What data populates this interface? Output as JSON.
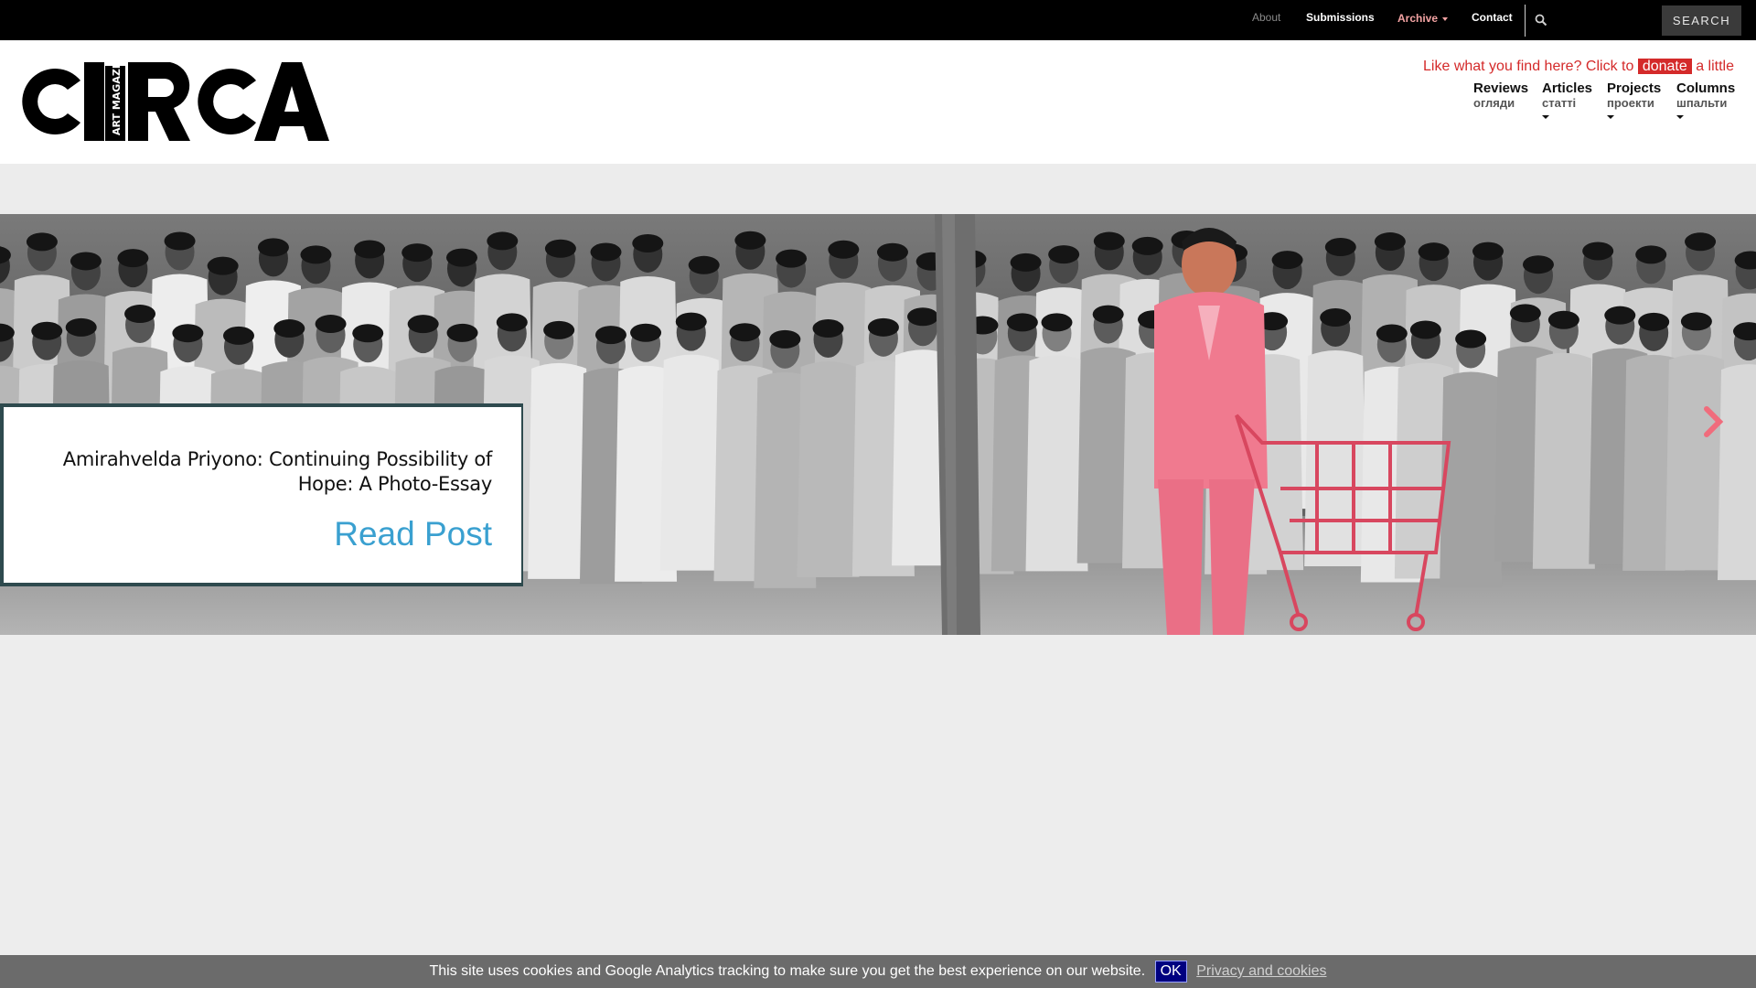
{
  "topbar": {
    "links": [
      {
        "label": "About"
      },
      {
        "label": "Submissions"
      },
      {
        "label": "Archive"
      },
      {
        "label": "Contact"
      }
    ],
    "search_button": "SEARCH"
  },
  "header": {
    "logo": {
      "main": "CIRCA",
      "sub1": "ART",
      "sub2": "MAGAZINE"
    },
    "donate": {
      "before": "Like what you find here? Click to ",
      "button": "donate",
      "after": " a little"
    },
    "nav": [
      {
        "label": "Reviews",
        "label_ua": "огляди"
      },
      {
        "label": "Articles",
        "label_ua": "статті"
      },
      {
        "label": "Projects",
        "label_ua": "проекти"
      },
      {
        "label": "Columns",
        "label_ua": "шпальти"
      }
    ]
  },
  "slider": {
    "post_title": "Amirahvelda Priyono: Continuing Possibility of Hope: A Photo-Essay",
    "read_post": "Read Post"
  },
  "cookie_bar": {
    "text": "This site uses cookies and Google Analytics tracking to make sure you get the best experience on our website.",
    "ok": "OK",
    "privacy": "Privacy and cookies"
  },
  "colors": {
    "topbar_bg": "#000000",
    "archive_link": "#f3a3a3",
    "donate_red": "#d42a2a",
    "read_post_blue": "#3aa0d0",
    "card_border": "#2e4a4e",
    "cookie_bg": "#6b6b6b",
    "ok_bg": "#000080",
    "suit_pink": "#f07a8f"
  },
  "icons": {
    "top_search": "search-icon",
    "slider_prev": "chevron-left-icon",
    "slider_next": "chevron-right-icon"
  }
}
